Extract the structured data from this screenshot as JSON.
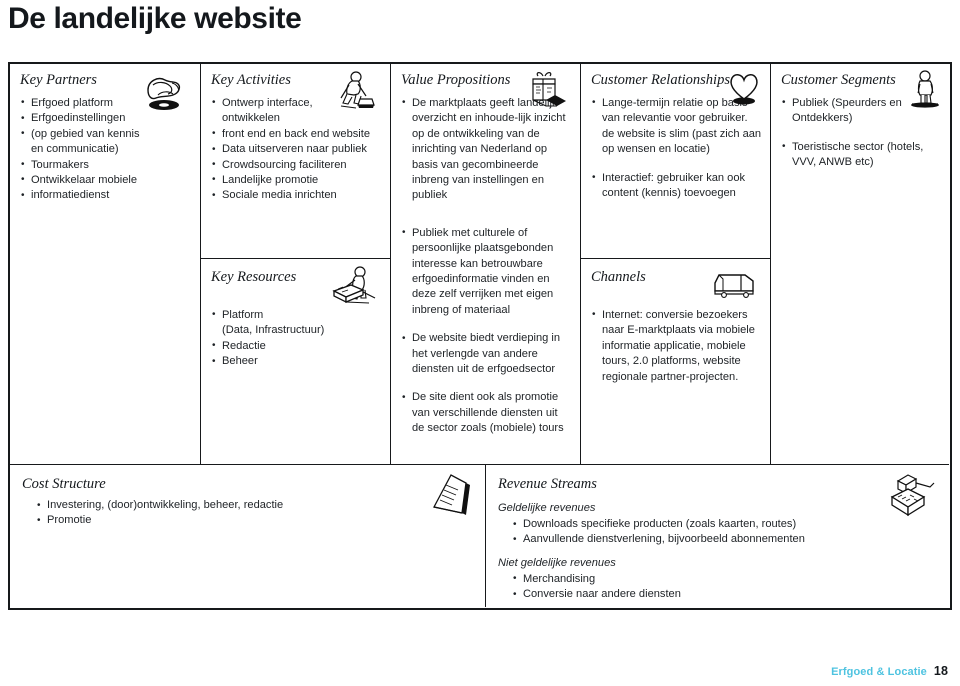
{
  "title": "De landelijke website",
  "footer": {
    "brand": "Erfgoed & Locatie",
    "page_number": "18"
  },
  "blocks": {
    "key_partners": {
      "heading": "Key Partners",
      "icon": "handshake-icon",
      "items": [
        "Erfgoed platform",
        "Erfgoedinstellingen",
        "(op gebied van kennis",
        "en communicatie)",
        "Tourmakers",
        "Ontwikkelaar mobiele",
        "informatiedienst"
      ]
    },
    "key_activities": {
      "heading": "Key Activities",
      "icon": "worker-sweeping-icon",
      "items": [
        "Ontwerp interface,\nontwikkelen",
        "front end en back end website",
        "Data uitserveren naar publiek",
        "Crowdsourcing faciliteren",
        "Landelijke promotie",
        "Sociale media inrichten"
      ]
    },
    "key_resources": {
      "heading": "Key Resources",
      "icon": "worker-with-machine-icon",
      "items": [
        "Platform\n(Data, Infrastructuur)",
        "Redactie",
        "Beheer"
      ]
    },
    "value_propositions": {
      "heading": "Value Propositions",
      "icon": "gift-box-icon",
      "items_top": [
        "De marktplaats geeft landelijk overzicht en inhoude-lijk inzicht op de ontwikkeling van de inrichting van Nederland op basis van gecombineerde inbreng van instellingen en publiek"
      ],
      "items_bottom": [
        "Publiek met culturele of persoonlijke plaatsgebonden interesse kan betrouwbare erfgoedinformatie vinden en deze zelf verrijken met eigen inbreng of materiaal",
        "De website biedt verdieping in het verlengde van andere diensten uit de erfgoedsector",
        "De site dient ook als promotie van verschillende diensten uit de sector zoals (mobiele) tours"
      ]
    },
    "customer_relationships": {
      "heading": "Customer Relationships",
      "icon": "heart-icon",
      "items": [
        "Lange-termijn relatie op basis van relevantie voor gebruiker. de website is slim (past zich aan op wensen en locatie)",
        "Interactief: gebruiker kan ook content (kennis) toevoegen"
      ]
    },
    "channels": {
      "heading": "Channels",
      "icon": "truck-icon",
      "items": [
        "Internet: conversie bezoekers naar E-marktplaats via mobiele informatie applicatie, mobiele tours, 2.0 platforms, website regionale partner-projecten."
      ]
    },
    "customer_segments": {
      "heading": "Customer Segments",
      "icon": "person-standing-icon",
      "items": [
        "Publiek (Speurders en Ontdekkers)",
        "Toeristische sector (hotels, VVV, ANWB etc)"
      ]
    },
    "cost_structure": {
      "heading": "Cost Structure",
      "icon": "invoice-papers-icon",
      "items": [
        "Investering, (door)ontwikkeling, beheer, redactie",
        "Promotie"
      ]
    },
    "revenue_streams": {
      "heading": "Revenue Streams",
      "icon": "cash-register-icon",
      "groups": [
        {
          "subheading": "Geldelijke revenues",
          "items": [
            "Downloads specifieke producten (zoals kaarten, routes)",
            "Aanvullende dienstverlening, bijvoorbeeld abonnementen"
          ]
        },
        {
          "subheading": "Niet geldelijke revenues",
          "items": [
            "Merchandising",
            "Conversie naar andere diensten"
          ]
        }
      ]
    }
  }
}
